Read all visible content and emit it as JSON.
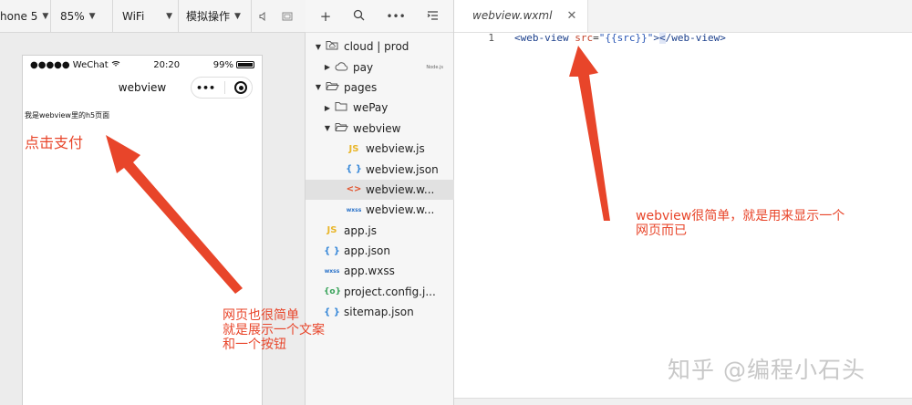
{
  "simulator": {
    "toolbar": {
      "device": "hone 5",
      "zoom": "85%",
      "network": "WiFi",
      "operation": "模拟操作"
    },
    "phone": {
      "carrier": "●●●●● WeChat",
      "time": "20:20",
      "battery": "99%",
      "battery_level": 0.99,
      "nav_title": "webview",
      "capsule_more": "•••",
      "web_text": "我是webview里的h5页面",
      "pay_link": "点击支付"
    }
  },
  "explorer": {
    "tree": [
      {
        "label": "cloud | prod",
        "icon": "cloud-folder-icon",
        "caret": "▼",
        "indent": 0
      },
      {
        "label": "pay",
        "icon": "cloud-icon",
        "caret": "▶",
        "indent": 1,
        "badge": "Node.js"
      },
      {
        "label": "pages",
        "icon": "folder-open-icon",
        "caret": "▼",
        "indent": 0
      },
      {
        "label": "wePay",
        "icon": "folder-icon",
        "caret": "▶",
        "indent": 1
      },
      {
        "label": "webview",
        "icon": "folder-open-icon",
        "caret": "▼",
        "indent": 1
      },
      {
        "label": "webview.js",
        "icon": "js-file-icon",
        "caret": "",
        "indent": 2
      },
      {
        "label": "webview.json",
        "icon": "json-file-icon",
        "caret": "",
        "indent": 2
      },
      {
        "label": "webview.w...",
        "icon": "wxml-file-icon",
        "caret": "",
        "indent": 2,
        "selected": true
      },
      {
        "label": "webview.w...",
        "icon": "wxss-file-icon",
        "caret": "",
        "indent": 2
      },
      {
        "label": "app.js",
        "icon": "js-file-icon",
        "caret": "",
        "indent": 0
      },
      {
        "label": "app.json",
        "icon": "json-file-icon",
        "caret": "",
        "indent": 0
      },
      {
        "label": "app.wxss",
        "icon": "wxss-file-icon",
        "caret": "",
        "indent": 0
      },
      {
        "label": "project.config.j...",
        "icon": "config-file-icon",
        "caret": "",
        "indent": 0
      },
      {
        "label": "sitemap.json",
        "icon": "json-file-icon",
        "caret": "",
        "indent": 0
      }
    ]
  },
  "editor": {
    "tab": {
      "label": "webview.wxml",
      "close": "✕"
    },
    "line_number": "1",
    "code": {
      "open_tag": "<web-view",
      "attr": "src",
      "eq": "=",
      "value": "\"{{src}}\"",
      "gt": ">",
      "cursor_char": "<",
      "close_tag": "/web-view>"
    }
  },
  "annotations": {
    "note_editor": "webview很简单，就是用来显示一个\n网页而已",
    "note_phone": "网页也很简单\n就是展示一个文案\n和一个按钮",
    "watermark": "知乎 @编程小石头"
  },
  "colors": {
    "annotation": "#e8452a",
    "tag": "#1b3f8b",
    "attr": "#c3442c"
  }
}
